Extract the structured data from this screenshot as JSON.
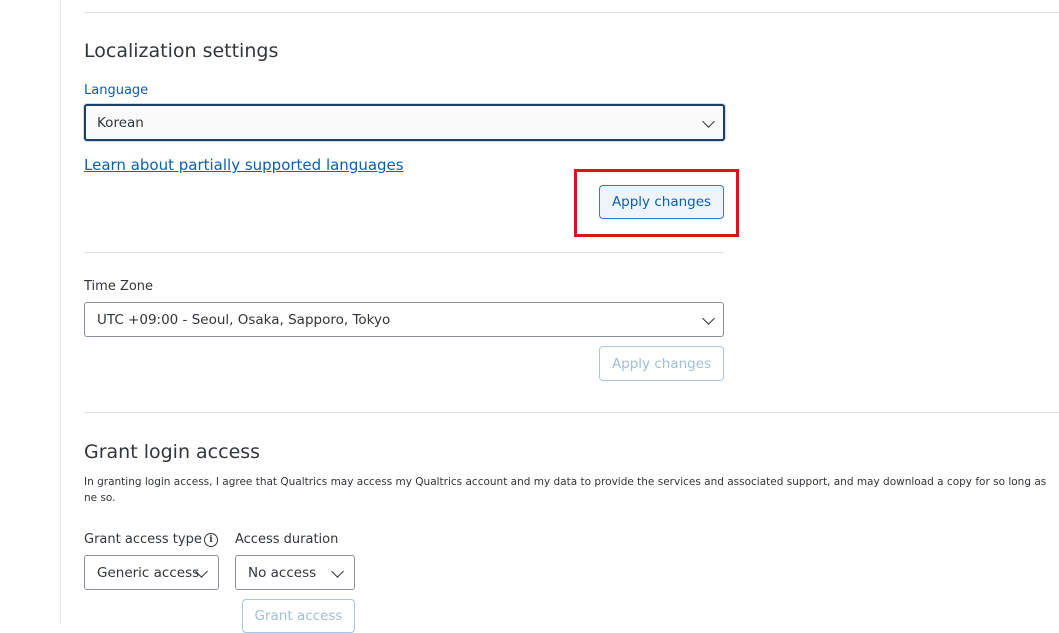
{
  "localization": {
    "title": "Localization settings",
    "language_label": "Language",
    "language_value": "Korean",
    "learn_link": "Learn about partially supported languages",
    "apply_label": "Apply changes"
  },
  "timezone": {
    "label": "Time Zone",
    "value": "UTC +09:00 - Seoul, Osaka, Sapporo, Tokyo",
    "apply_label": "Apply changes"
  },
  "grant": {
    "title": "Grant login access",
    "description": "In granting login access, I agree that Qualtrics may access my Qualtrics account and my data to provide the services and associated support, and may download a copy for so long as ne so.",
    "type_label": "Grant access type",
    "type_value": "Generic access",
    "duration_label": "Access duration",
    "duration_value": "No access",
    "grant_button": "Grant access"
  },
  "icons": {
    "chevron": "chevron-down-icon",
    "info": "info-icon"
  },
  "colors": {
    "link_blue": "#0b5fb4",
    "highlight_red": "#d9151b",
    "focus_border": "#1d3f66"
  }
}
